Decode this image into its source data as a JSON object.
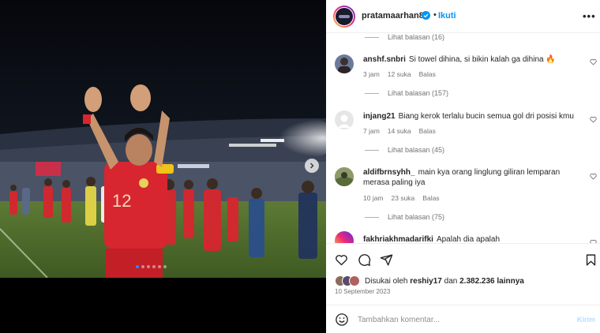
{
  "header": {
    "username": "pratamaarhan8",
    "separator": "•",
    "follow_label": "Ikuti",
    "more_label": "•••"
  },
  "comments": [
    {
      "view_replies": "Lihat balasan (16)"
    },
    {
      "username": "anshf.snbri",
      "text": "Si towel dihina, si bikin kalah ga dihina",
      "emoji": "🔥",
      "time": "3 jam",
      "likes": "12 suka",
      "reply": "Balas",
      "view_replies": "Lihat balasan (157)"
    },
    {
      "username": "injang21",
      "text": "Biang kerok terlalu bucin semua gol dri posisi kmu",
      "time": "7 jam",
      "likes": "14 suka",
      "reply": "Balas",
      "view_replies": "Lihat balasan (45)"
    },
    {
      "username": "aldifbrnsyhh_",
      "text": "main kya orang linglung giliran lemparan merasa paling iya",
      "time": "10 jam",
      "likes": "23 suka",
      "reply": "Balas",
      "view_replies": "Lihat balasan (75)"
    },
    {
      "username": "fakhriakhmadarifki",
      "text": "Apalah dia apalah"
    }
  ],
  "likes": {
    "prefix": "Disukai oleh",
    "user": "reshiy17",
    "middle": "dan",
    "count": "2.382.236 lainnya"
  },
  "date": "10 September 2023",
  "add_comment": {
    "placeholder": "Tambahkan komentar...",
    "post_label": "Kirim"
  },
  "colors": {
    "accent": "#0095f6",
    "jersey_red": "#d7262f",
    "pitch_green": "#4a6a2a"
  },
  "icons": [
    "heart-icon",
    "comment-icon",
    "share-icon",
    "bookmark-icon",
    "emoji-icon",
    "verified-icon",
    "next-arrow-icon"
  ]
}
